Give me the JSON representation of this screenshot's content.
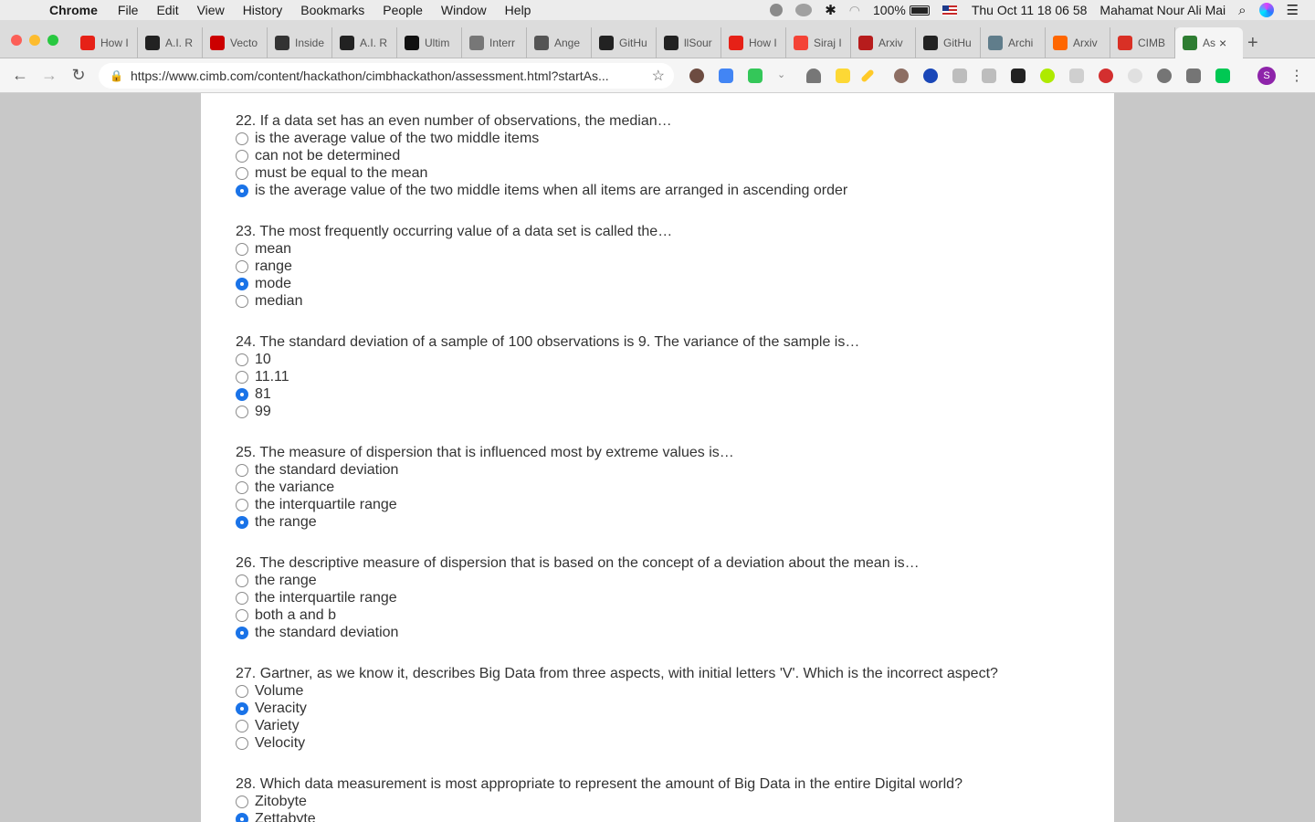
{
  "menubar": {
    "app": "Chrome",
    "items": [
      "File",
      "Edit",
      "View",
      "History",
      "Bookmarks",
      "People",
      "Window",
      "Help"
    ],
    "battery": "100%",
    "datetime": "Thu Oct 11  18 06 58",
    "user": "Mahamat Nour Ali Mai"
  },
  "tabs": [
    {
      "label": "How I",
      "icon": "youtube-icon"
    },
    {
      "label": "A.I. R",
      "icon": "nyt-icon"
    },
    {
      "label": "Vecto",
      "icon": "vector-icon"
    },
    {
      "label": "Inside",
      "icon": "inside-icon"
    },
    {
      "label": "A.I. R",
      "icon": "nyt-icon"
    },
    {
      "label": "Ultim",
      "icon": "medium-icon"
    },
    {
      "label": "Interr",
      "icon": "interr-icon"
    },
    {
      "label": "Ange",
      "icon": "angel-icon"
    },
    {
      "label": "GitHu",
      "icon": "github-icon"
    },
    {
      "label": "llSour",
      "icon": "github-icon"
    },
    {
      "label": "How I",
      "icon": "youtube-icon"
    },
    {
      "label": "Siraj I",
      "icon": "siraj-icon"
    },
    {
      "label": "Arxiv",
      "icon": "arxiv-sanity-icon"
    },
    {
      "label": "GitHu",
      "icon": "github-icon"
    },
    {
      "label": "Archi",
      "icon": "archive-icon"
    },
    {
      "label": "Arxiv",
      "icon": "ycombinator-icon"
    },
    {
      "label": "CIMB",
      "icon": "gmail-icon"
    },
    {
      "label": "As",
      "icon": "cimb-icon",
      "active": true
    }
  ],
  "url": "https://www.cimb.com/content/hackathon/cimbhackathon/assessment.html?startAs...",
  "profile_initial": "S",
  "questions": [
    {
      "text": "22. If a data set has an even number of observations, the median…",
      "options": [
        {
          "label": "is the average value of the two middle items",
          "selected": false
        },
        {
          "label": "can not be determined",
          "selected": false
        },
        {
          "label": "must be equal to the mean",
          "selected": false
        },
        {
          "label": "is the average value of the two middle items when all items are arranged in ascending order",
          "selected": true
        }
      ]
    },
    {
      "text": "23. The most frequently occurring value of a data set is called the…",
      "options": [
        {
          "label": "mean",
          "selected": false
        },
        {
          "label": "range",
          "selected": false
        },
        {
          "label": "mode",
          "selected": true
        },
        {
          "label": "median",
          "selected": false
        }
      ]
    },
    {
      "text": "24. The standard deviation of a sample of 100 observations is 9. The variance of the sample is…",
      "options": [
        {
          "label": "10",
          "selected": false
        },
        {
          "label": "11.11",
          "selected": false
        },
        {
          "label": "81",
          "selected": true
        },
        {
          "label": "99",
          "selected": false
        }
      ]
    },
    {
      "text": "25. The measure of dispersion that is influenced most by extreme values is…",
      "options": [
        {
          "label": "the standard deviation",
          "selected": false
        },
        {
          "label": "the variance",
          "selected": false
        },
        {
          "label": "the interquartile range",
          "selected": false
        },
        {
          "label": "the range",
          "selected": true
        }
      ]
    },
    {
      "text": "26. The descriptive measure of dispersion that is based on the concept of a deviation about the mean is…",
      "options": [
        {
          "label": "the range",
          "selected": false
        },
        {
          "label": "the interquartile range",
          "selected": false
        },
        {
          "label": "both a and b",
          "selected": false
        },
        {
          "label": "the standard deviation",
          "selected": true
        }
      ]
    },
    {
      "text": "27. Gartner, as we know it, describes Big Data from three aspects, with initial letters 'V'. Which is the incorrect aspect?",
      "options": [
        {
          "label": "Volume",
          "selected": false
        },
        {
          "label": "Veracity",
          "selected": true
        },
        {
          "label": "Variety",
          "selected": false
        },
        {
          "label": "Velocity",
          "selected": false
        }
      ]
    },
    {
      "text": "28. Which data measurement is most appropriate to represent the amount of Big Data in the entire Digital world?",
      "options": [
        {
          "label": "Zitobyte",
          "selected": false
        },
        {
          "label": "Zettabyte",
          "selected": true
        }
      ]
    }
  ],
  "colors": {
    "radio_selected": "#1a73e8",
    "page_bg": "#c8c8c8",
    "text": "#333333"
  }
}
